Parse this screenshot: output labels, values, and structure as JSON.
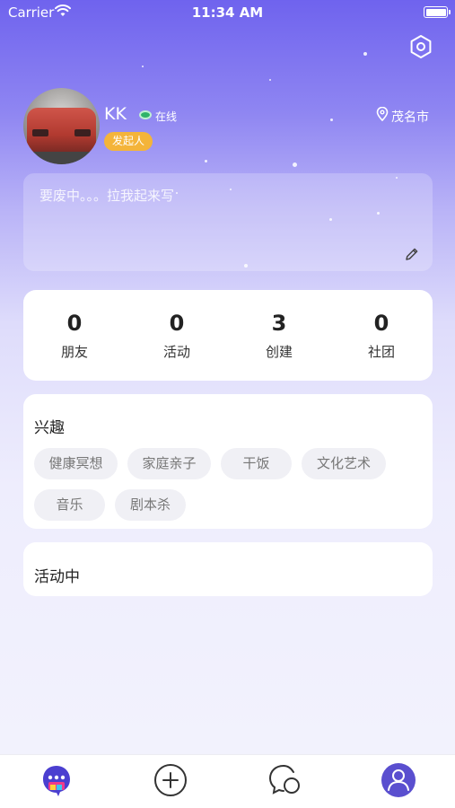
{
  "status_bar": {
    "carrier": "Carrier",
    "time": "11:34 AM"
  },
  "profile": {
    "username": "KK",
    "online_status": "在线",
    "role_badge": "发起人",
    "location": "茂名市",
    "bio_placeholder": "要废中。。。拉我起来写"
  },
  "stats": [
    {
      "value": "0",
      "label": "朋友"
    },
    {
      "value": "0",
      "label": "活动"
    },
    {
      "value": "3",
      "label": "创建"
    },
    {
      "value": "0",
      "label": "社团"
    }
  ],
  "interests": {
    "title": "兴趣",
    "tags": [
      "健康冥想",
      "家庭亲子",
      "干饭",
      "文化艺术",
      "音乐",
      "剧本杀"
    ]
  },
  "activity": {
    "title": "活动中"
  },
  "tab_bar": {
    "tabs": [
      {
        "icon": "home-chat-icon",
        "active": false
      },
      {
        "icon": "add-circle-icon",
        "active": false
      },
      {
        "icon": "message-bubble-icon",
        "active": false
      },
      {
        "icon": "profile-icon",
        "active": true
      }
    ]
  },
  "colors": {
    "accent": "#6f63ee",
    "badge": "#f4b43a",
    "online": "#2fb36a",
    "tag_bg": "#f0f0f5",
    "tab_active": "#5a4fcf"
  }
}
